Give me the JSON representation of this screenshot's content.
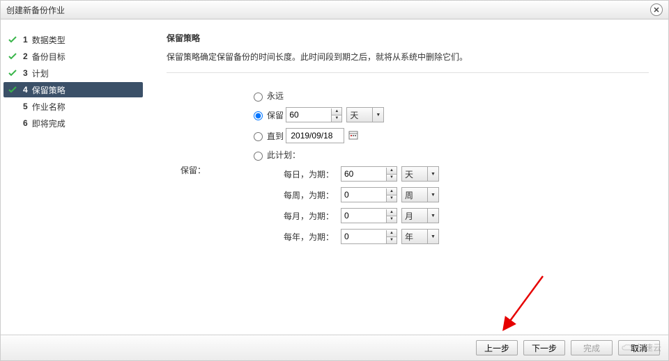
{
  "window": {
    "title": "创建新备份作业"
  },
  "steps": [
    {
      "num": "1",
      "label": "数据类型",
      "done": true,
      "active": false
    },
    {
      "num": "2",
      "label": "备份目标",
      "done": true,
      "active": false
    },
    {
      "num": "3",
      "label": "计划",
      "done": true,
      "active": false
    },
    {
      "num": "4",
      "label": "保留策略",
      "done": true,
      "active": true
    },
    {
      "num": "5",
      "label": "作业名称",
      "done": false,
      "active": false
    },
    {
      "num": "6",
      "label": "即将完成",
      "done": false,
      "active": false
    }
  ],
  "section": {
    "title": "保留策略",
    "desc": "保留策略确定保留备份的时间长度。此时间段到期之后，就将从系统中删除它们。"
  },
  "form": {
    "retain_label": "保留：",
    "options": {
      "forever": "永远",
      "keep": "保留",
      "until": "直到",
      "this_plan": "此计划："
    },
    "keep_value": "60",
    "keep_unit": "天",
    "until_date": "2019/09/18",
    "schedule": {
      "daily": {
        "label": "每日，为期：",
        "value": "60",
        "unit": "天"
      },
      "weekly": {
        "label": "每周，为期：",
        "value": "0",
        "unit": "周"
      },
      "monthly": {
        "label": "每月，为期：",
        "value": "0",
        "unit": "月"
      },
      "yearly": {
        "label": "每年，为期：",
        "value": "0",
        "unit": "年"
      }
    }
  },
  "footer": {
    "prev": "上一步",
    "next": "下一步",
    "finish": "完成",
    "cancel": "取消"
  },
  "watermark": "亿速云"
}
